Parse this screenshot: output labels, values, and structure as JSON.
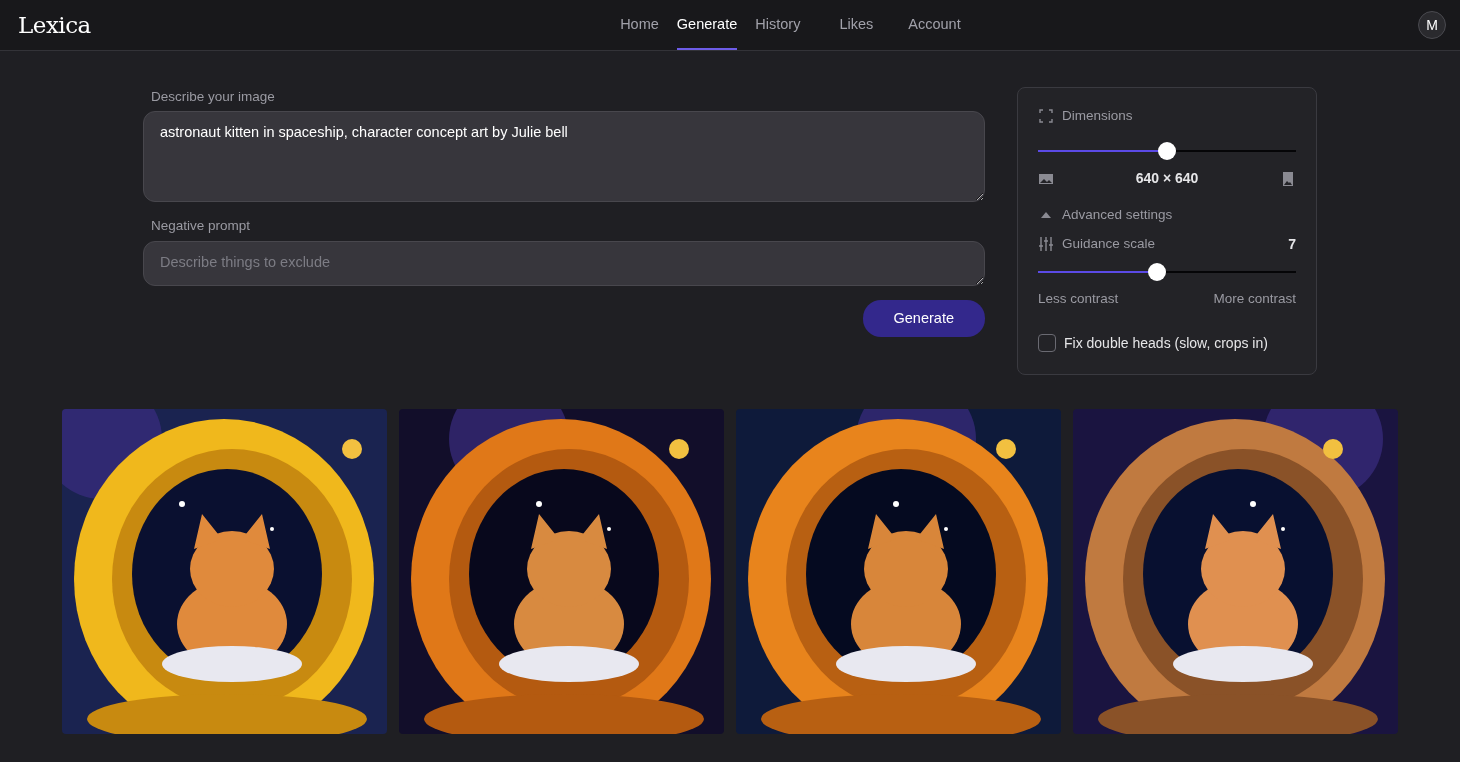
{
  "brand": "Lexica",
  "nav": [
    {
      "label": "Home",
      "selected": false
    },
    {
      "label": "Generate",
      "selected": true
    },
    {
      "label": "History",
      "selected": false
    },
    {
      "label": "Likes",
      "selected": false
    },
    {
      "label": "Account",
      "selected": false
    }
  ],
  "avatar": "M",
  "prompt": {
    "label": "Describe your image",
    "value": "astronaut kitten in spaceship, character concept art by Julie bell"
  },
  "negative_prompt": {
    "label": "Negative prompt",
    "placeholder": "Describe things to exclude"
  },
  "generate_button": "Generate",
  "settings": {
    "dimensions": {
      "label": "Dimensions",
      "level": 0.5,
      "reading": "640 × 640"
    },
    "advanced": {
      "label": "Advanced settings",
      "expanded": true
    },
    "guidance": {
      "label": "Guidance scale",
      "value": "7",
      "level": 0.46,
      "min_label": "Less contrast",
      "max_label": "More contrast"
    },
    "fix_double_heads": {
      "label": "Fix double heads (slow, crops in)",
      "checked": false
    }
  }
}
